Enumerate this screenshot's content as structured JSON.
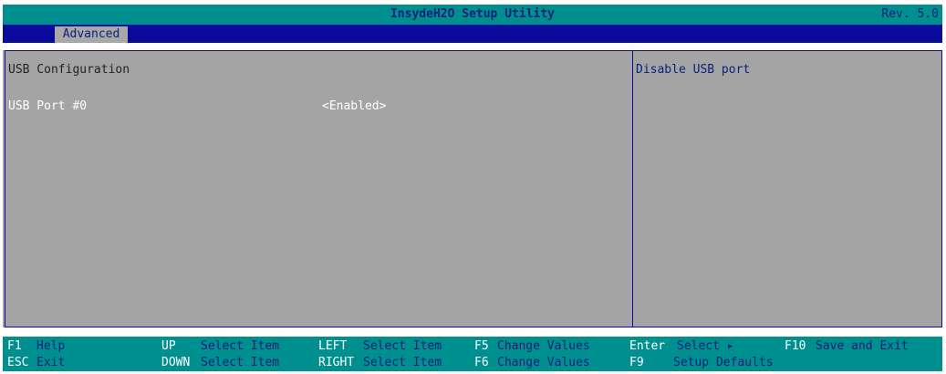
{
  "title": "InsydeH2O Setup Utility",
  "revision": "Rev. 5.0",
  "tabs": [
    {
      "label": "Advanced"
    }
  ],
  "section_title": "USB Configuration",
  "options": [
    {
      "label": "USB Port #0",
      "value": "<Enabled>"
    }
  ],
  "help_text": "Disable USB port",
  "footer": {
    "row1": [
      {
        "key": "F1",
        "action": "Help"
      },
      {
        "key": "UP",
        "action": "Select Item"
      },
      {
        "key": "LEFT",
        "action": "Select Item"
      },
      {
        "key": "F5",
        "action": "Change Values"
      },
      {
        "key": "Enter",
        "action": "Select ▸"
      },
      {
        "key": "F10",
        "action": "Save and Exit"
      }
    ],
    "row2": [
      {
        "key": "ESC",
        "action": "Exit"
      },
      {
        "key": "DOWN",
        "action": "Select Item"
      },
      {
        "key": "RIGHT",
        "action": "Select Item"
      },
      {
        "key": "F6",
        "action": "Change Values"
      },
      {
        "key": "F9",
        "action": "Setup Defaults"
      }
    ]
  },
  "colors": {
    "title_bar": "#008f8f",
    "tab_bar": "#0a0a9c",
    "main_bg": "#a4a4a4",
    "text_blue": "#0a1f7a",
    "text_white": "#ffffff"
  }
}
